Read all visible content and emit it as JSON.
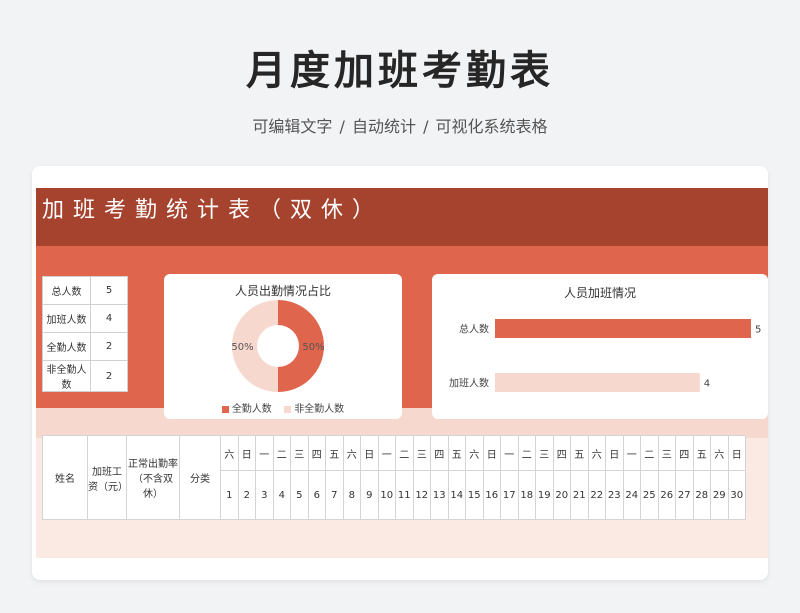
{
  "header": {
    "title": "月度加班考勤表",
    "subtitle": "可编辑文字 / 自动统计 / 可视化系统表格"
  },
  "sheet": {
    "title": "加班考勤统计表（双休）"
  },
  "summary": [
    {
      "label": "总人数",
      "value": "5"
    },
    {
      "label": "加班人数",
      "value": "4"
    },
    {
      "label": "全勤人数",
      "value": "2"
    },
    {
      "label": "非全勤人数",
      "value": "2"
    }
  ],
  "chart_data": [
    {
      "type": "pie",
      "title": "人员出勤情况占比",
      "categories": [
        "全勤人数",
        "非全勤人数"
      ],
      "values": [
        50,
        50
      ],
      "labels": [
        "50%",
        "50%"
      ],
      "colors": [
        "#e0654d",
        "#f7d8cf"
      ],
      "donut": true,
      "legend": "bottom"
    },
    {
      "type": "bar",
      "orientation": "horizontal",
      "title": "人员加班情况",
      "categories": [
        "总人数",
        "加班人数"
      ],
      "values": [
        5,
        4
      ],
      "colors": [
        "#e0654d",
        "#f7d8cf"
      ],
      "xlim": [
        0,
        5
      ]
    }
  ],
  "table": {
    "headers": {
      "name": "姓名",
      "wage": "加班工资（元）",
      "rate": "正常出勤率（不含双休）",
      "category": "分类"
    },
    "weekdays": [
      "六",
      "日",
      "一",
      "二",
      "三",
      "四",
      "五",
      "六",
      "日",
      "一",
      "二",
      "三",
      "四",
      "五",
      "六",
      "日",
      "一",
      "二",
      "三",
      "四",
      "五",
      "六",
      "日",
      "一",
      "二",
      "三",
      "四",
      "五",
      "六",
      "日"
    ],
    "days": [
      "1",
      "2",
      "3",
      "4",
      "5",
      "6",
      "7",
      "8",
      "9",
      "10",
      "11",
      "12",
      "13",
      "14",
      "15",
      "16",
      "17",
      "18",
      "19",
      "20",
      "21",
      "22",
      "23",
      "24",
      "25",
      "26",
      "27",
      "28",
      "29",
      "30"
    ]
  },
  "colors": {
    "banner": "#a5432f",
    "accent": "#e0654d",
    "light": "#f7d8cf",
    "pale": "#fbe9e3"
  }
}
